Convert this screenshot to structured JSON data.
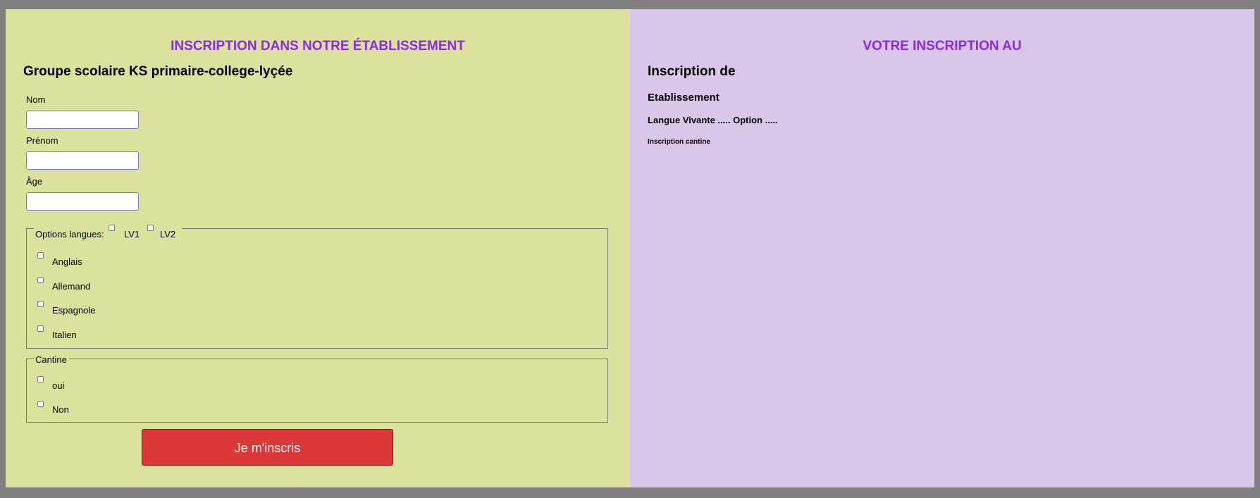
{
  "form": {
    "title": "INSCRIPTION DANS NOTRE ÉTABLISSEMENT",
    "school_name": "Groupe scolaire KS primaire-college-lyçée",
    "fields": {
      "nom_label": "Nom",
      "nom_value": "",
      "prenom_label": "Prénom",
      "prenom_value": "",
      "age_label": "Âge",
      "age_value": ""
    },
    "languages": {
      "legend": "Options langues:",
      "lv1": "LV1",
      "lv2": "LV2",
      "options": [
        "Anglais",
        "Allemand",
        "Espagnole",
        "Italien"
      ]
    },
    "cantine": {
      "legend": "Cantine",
      "options": [
        "oui",
        "Non"
      ]
    },
    "submit_label": "Je m'inscris"
  },
  "summary": {
    "title": "VOTRE INSCRIPTION AU",
    "inscription_de": "Inscription de",
    "etablissement": "Etablissement",
    "langue_line": "Langue Vivante ..... Option .....",
    "cantine_line": "Inscription cantine"
  },
  "colors": {
    "left_panel": "#dce29e",
    "right_panel": "#d9c6e8",
    "title_accent": "#8a2be2",
    "submit_button": "#dc3838"
  }
}
